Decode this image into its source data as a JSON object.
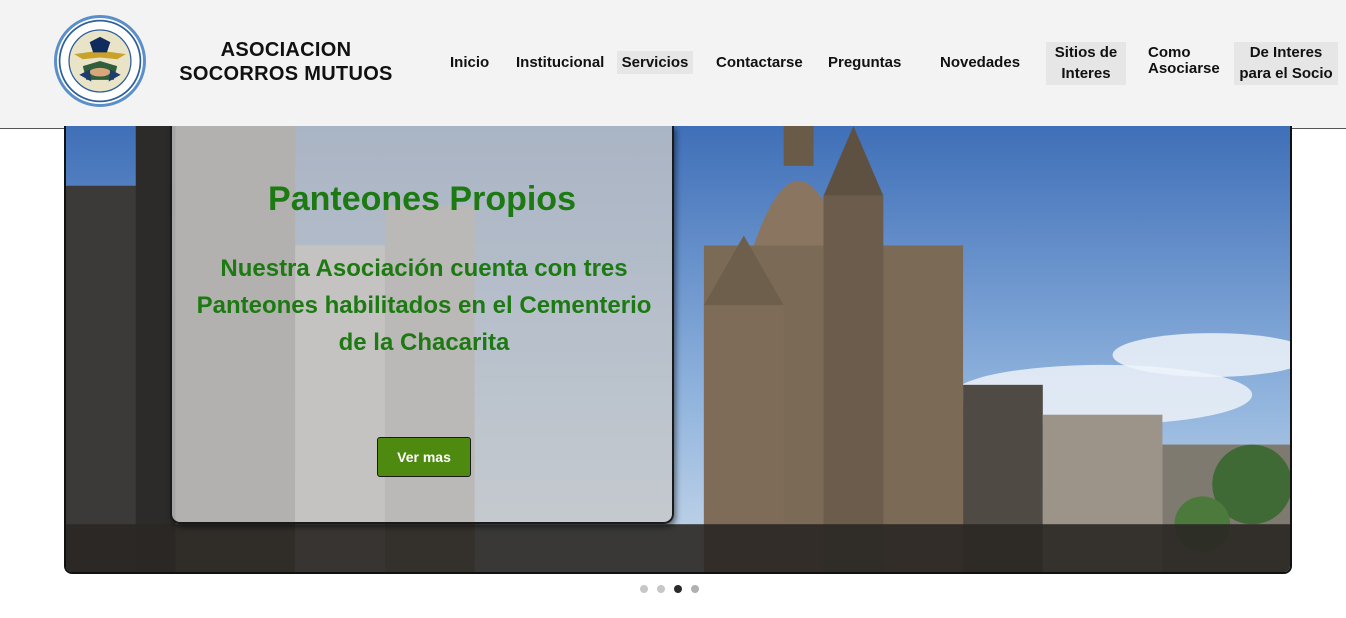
{
  "brand": {
    "line1": "ASOCIACION",
    "line2": "SOCORROS MUTUOS",
    "logo_icon": "association-emblem-icon"
  },
  "nav": {
    "inicio": "Inicio",
    "institucional": "Institucional",
    "servicios": "Servicios",
    "contactarse": "Contactarse",
    "preguntas": "Preguntas",
    "novedades": "Novedades",
    "sitios_l1": "Sitios de",
    "sitios_l2": "Interes",
    "como_l1": "Como",
    "como_l2": "Asociarse",
    "deinteres_l1": "De Interes",
    "deinteres_l2": "para el Socio"
  },
  "slide": {
    "title": "Panteones Propios",
    "text": "Nuestra Asociación cuenta con tres Panteones habilitados en el Cementerio de la Chacarita",
    "button": "Ver mas"
  },
  "carousel": {
    "slide_count": 4,
    "active_index": 2
  },
  "colors": {
    "accent_green": "#1d7a12",
    "button_green": "#4f8a10",
    "header_bg": "#f3f3f3"
  }
}
